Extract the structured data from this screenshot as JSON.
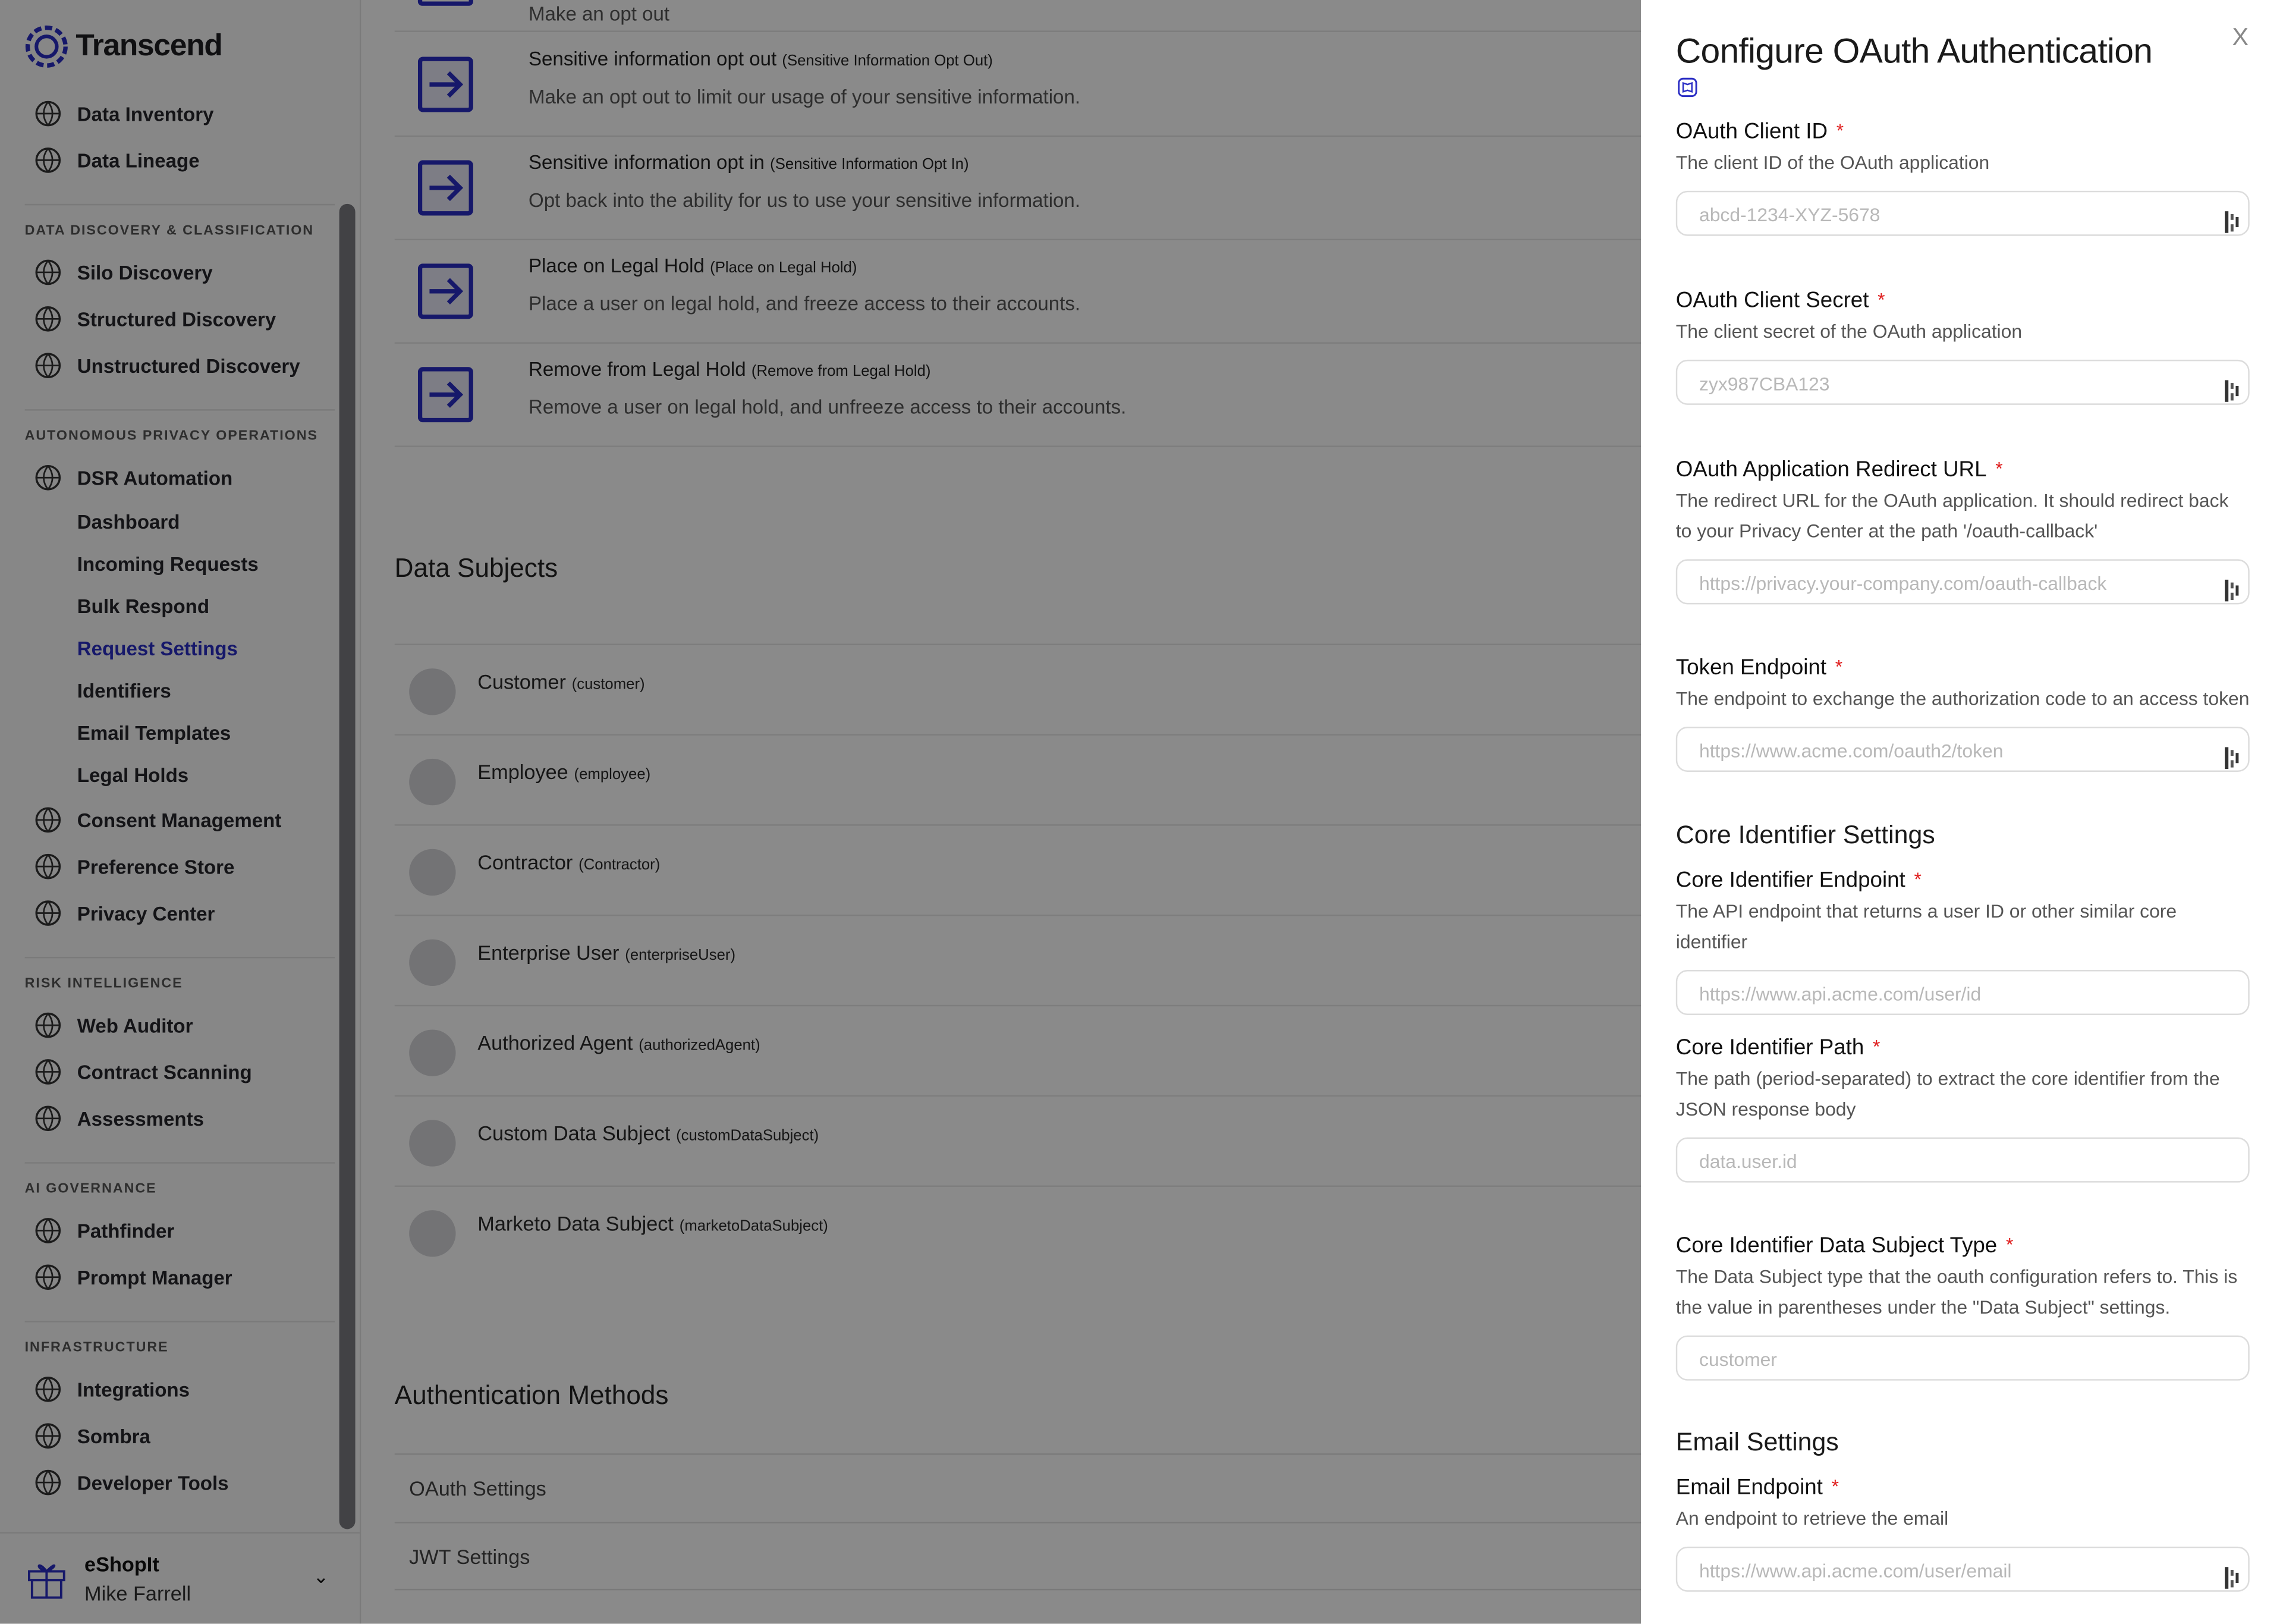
{
  "app": {
    "brand": "Transcend",
    "accent": "#2a2dc4"
  },
  "sidebar": {
    "top_items": [
      {
        "label": "Data Inventory",
        "icon": "globe-icon"
      },
      {
        "label": "Data Lineage",
        "icon": "lineage-icon"
      }
    ],
    "sections": [
      {
        "title": "DATA DISCOVERY & CLASSIFICATION",
        "items": [
          {
            "label": "Silo Discovery",
            "icon": "cube-icon"
          },
          {
            "label": "Structured Discovery",
            "icon": "structured-cube-icon"
          },
          {
            "label": "Unstructured Discovery",
            "icon": "unstructured-globe-icon"
          }
        ]
      },
      {
        "title": "AUTONOMOUS PRIVACY OPERATIONS",
        "items": [
          {
            "label": "DSR Automation",
            "icon": "users-icon",
            "children": [
              "Dashboard",
              "Incoming Requests",
              "Bulk Respond",
              "Request Settings",
              "Identifiers",
              "Email Templates",
              "Legal Holds"
            ],
            "active_child": "Request Settings"
          },
          {
            "label": "Consent Management",
            "icon": "consent-icon"
          },
          {
            "label": "Preference Store",
            "icon": "database-icon"
          },
          {
            "label": "Privacy Center",
            "icon": "privacy-center-icon"
          }
        ]
      },
      {
        "title": "RISK INTELLIGENCE",
        "items": [
          {
            "label": "Web Auditor",
            "icon": "web-auditor-icon"
          },
          {
            "label": "Contract Scanning",
            "icon": "contract-icon"
          },
          {
            "label": "Assessments",
            "icon": "assessment-icon"
          }
        ]
      },
      {
        "title": "AI GOVERNANCE",
        "items": [
          {
            "label": "Pathfinder",
            "icon": "compass-icon"
          },
          {
            "label": "Prompt Manager",
            "icon": "prompt-icon"
          }
        ]
      },
      {
        "title": "INFRASTRUCTURE",
        "items": [
          {
            "label": "Integrations",
            "icon": "integrations-icon"
          },
          {
            "label": "Sombra",
            "icon": "eye-off-icon"
          },
          {
            "label": "Developer Tools",
            "icon": "developer-icon"
          }
        ]
      }
    ],
    "account": {
      "org": "eShopIt",
      "user": "Mike Farrell"
    }
  },
  "main": {
    "partial_top_text": "Make an opt out",
    "actions": [
      {
        "title": "Sensitive information opt out",
        "key": "(Sensitive Information Opt Out)",
        "desc": "Make an opt out to limit our usage of your sensitive information."
      },
      {
        "title": "Sensitive information opt in",
        "key": "(Sensitive Information Opt In)",
        "desc": "Opt back into the ability for us to use your sensitive information."
      },
      {
        "title": "Place on Legal Hold",
        "key": "(Place on Legal Hold)",
        "desc": "Place a user on legal hold, and freeze access to their accounts."
      },
      {
        "title": "Remove from Legal Hold",
        "key": "(Remove from Legal Hold)",
        "desc": "Remove a user on legal hold, and unfreeze access to their accounts."
      }
    ],
    "data_subjects_title": "Data Subjects",
    "data_subjects": [
      {
        "name": "Customer",
        "key": "(customer)"
      },
      {
        "name": "Employee",
        "key": "(employee)"
      },
      {
        "name": "Contractor",
        "key": "(Contractor)"
      },
      {
        "name": "Enterprise User",
        "key": "(enterpriseUser)"
      },
      {
        "name": "Authorized Agent",
        "key": "(authorizedAgent)"
      },
      {
        "name": "Custom Data Subject",
        "key": "(customDataSubject)"
      },
      {
        "name": "Marketo Data Subject",
        "key": "(marketoDataSubject)"
      }
    ],
    "auth_title": "Authentication Methods",
    "auth_methods": [
      "OAuth Settings",
      "JWT Settings"
    ]
  },
  "drawer": {
    "title": "Configure OAuth Authentication",
    "close": "X",
    "required_mark": "*",
    "fields": [
      {
        "label": "OAuth Client ID",
        "help": "The client ID of the OAuth application",
        "placeholder": "abcd-1234-XYZ-5678",
        "pm": true
      },
      {
        "label": "OAuth Client Secret",
        "help": "The client secret of the OAuth application",
        "placeholder": "zyx987CBA123",
        "pm": true
      },
      {
        "label": "OAuth Application Redirect URL",
        "help": "The redirect URL for the OAuth application. It should redirect back to your Privacy Center at the path '/oauth-callback'",
        "placeholder": "https://privacy.your-company.com/oauth-callback",
        "pm": true
      },
      {
        "label": "Token Endpoint",
        "help": "The endpoint to exchange the authorization code to an access token",
        "placeholder": "https://www.acme.com/oauth2/token",
        "pm": true
      },
      {
        "label": "Core Identifier Endpoint",
        "help": "The API endpoint that returns a user ID or other similar core identifier",
        "placeholder": "https://www.api.acme.com/user/id",
        "pm": false
      },
      {
        "label": "Core Identifier Path",
        "help": "The path (period-separated) to extract the core identifier from the JSON response body",
        "placeholder": "data.user.id",
        "pm": false
      },
      {
        "label": "Core Identifier Data Subject Type",
        "help": "The Data Subject type that the oauth configuration refers to. This is the value in parentheses under the \"Data Subject\" settings.",
        "placeholder": "customer",
        "pm": false
      },
      {
        "label": "Email Endpoint",
        "help": "An endpoint to retrieve the email",
        "placeholder": "https://www.api.acme.com/user/email",
        "pm": true
      }
    ],
    "sections": [
      "Core Identifier Settings",
      "Email Settings"
    ]
  }
}
